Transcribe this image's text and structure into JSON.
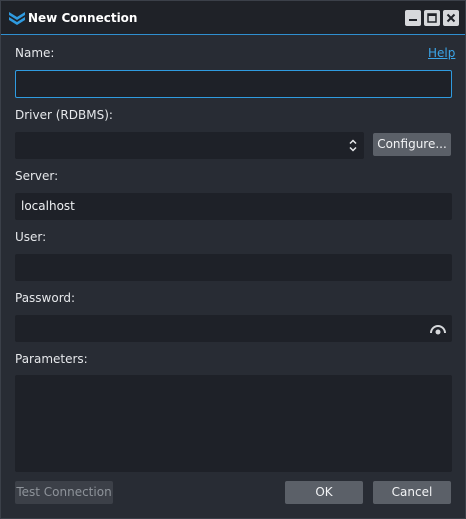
{
  "window": {
    "title": "New Connection",
    "icons": {
      "app": "app-logo-icon",
      "minimize": "minimize-icon",
      "maximize": "maximize-icon",
      "close": "close-icon"
    }
  },
  "form": {
    "name_label": "Name:",
    "name_value": "",
    "help_label": "Help",
    "driver_label": "Driver (RDBMS):",
    "driver_value": "",
    "configure_label": "Configure...",
    "server_label": "Server:",
    "server_value": "localhost",
    "user_label": "User:",
    "user_value": "",
    "password_label": "Password:",
    "password_value": "",
    "parameters_label": "Parameters:",
    "parameters_value": ""
  },
  "footer": {
    "test_label": "Test Connection",
    "ok_label": "OK",
    "cancel_label": "Cancel"
  },
  "colors": {
    "accent": "#2f9be0",
    "link": "#3aa5e8",
    "background": "#282c34",
    "field": "#1e2128"
  }
}
